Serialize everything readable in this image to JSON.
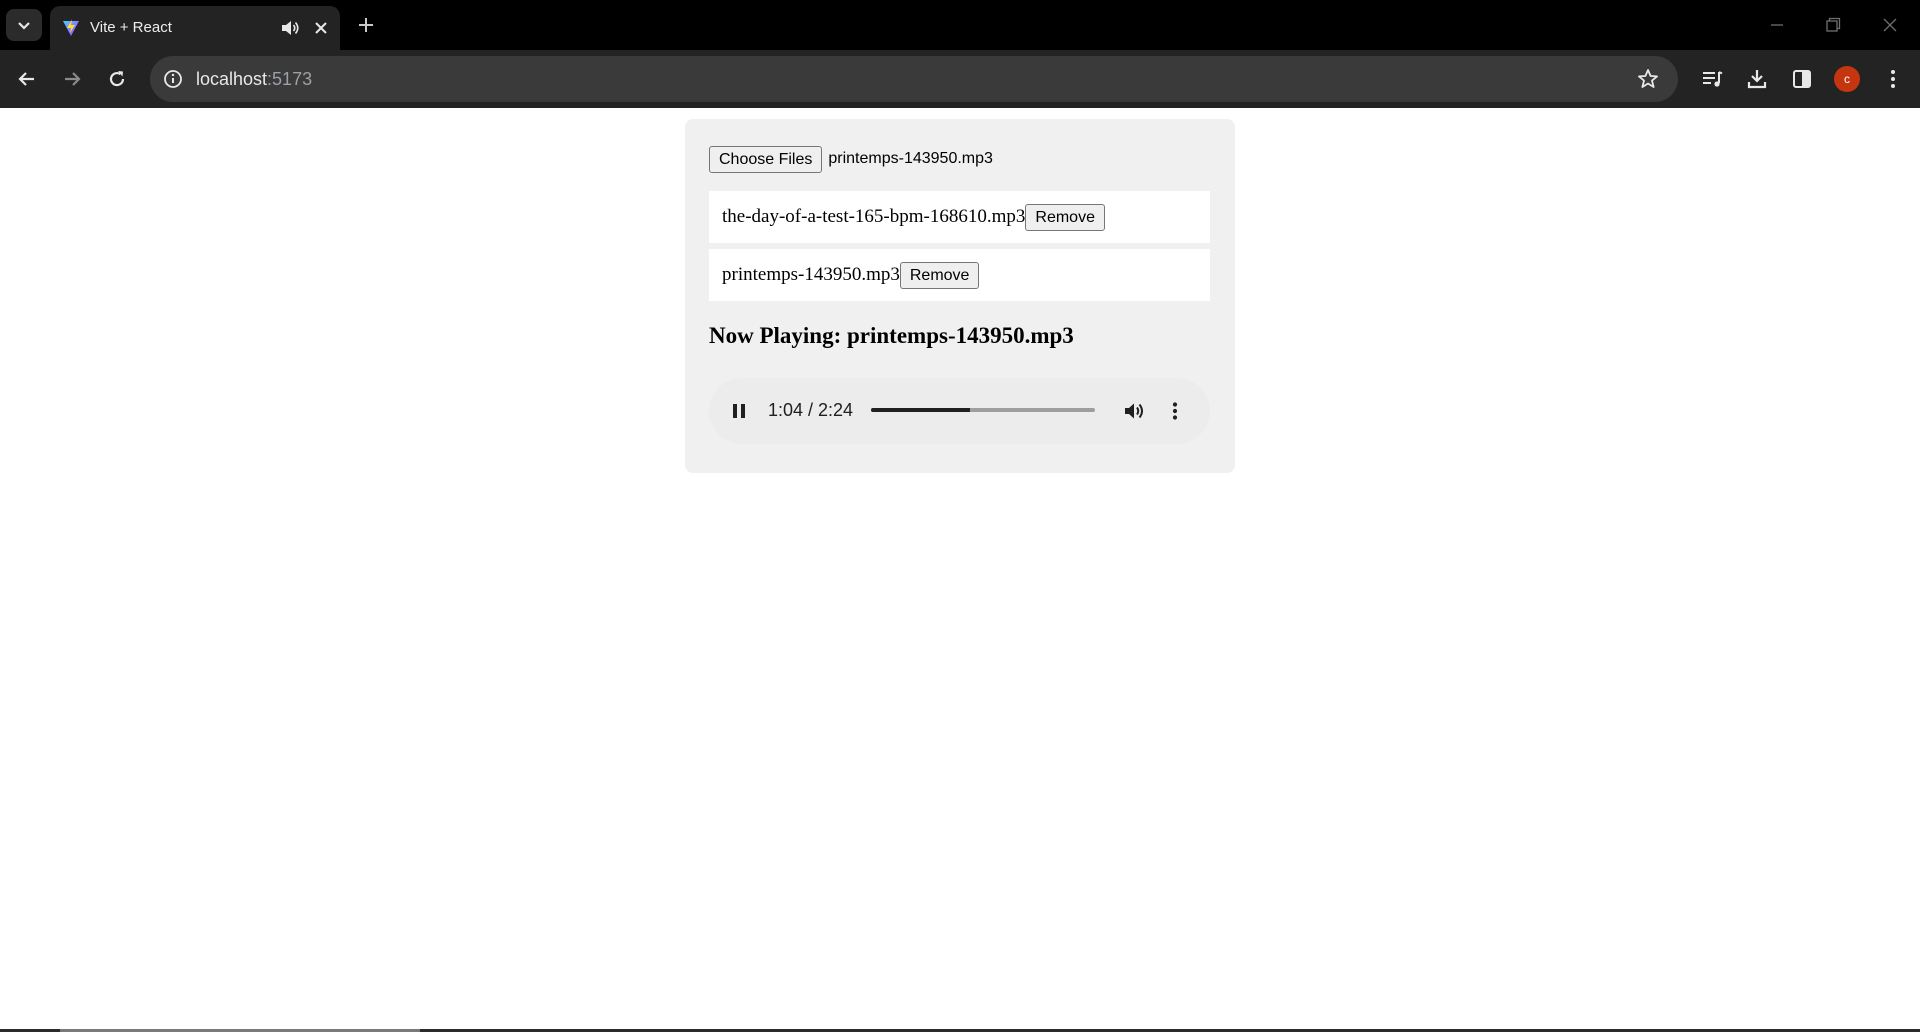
{
  "browser": {
    "tab": {
      "title": "Vite + React"
    },
    "address": {
      "host": "localhost",
      "port": ":5173"
    },
    "profile_initial": "c"
  },
  "app": {
    "file_input": {
      "button_label": "Choose Files",
      "selected_file": "printemps-143950.mp3"
    },
    "tracks": [
      {
        "name": "the-day-of-a-test-165-bpm-168610.mp3",
        "remove_label": "Remove"
      },
      {
        "name": "printemps-143950.mp3",
        "remove_label": "Remove"
      }
    ],
    "now_playing": "Now Playing: printemps-143950.mp3",
    "player": {
      "state": "playing",
      "time_display": "1:04 / 2:24",
      "progress_fraction": 0.444
    }
  },
  "colors": {
    "avatar": "#c5350f",
    "chrome_dark": "#232323",
    "card_bg": "#f0f0f0"
  }
}
